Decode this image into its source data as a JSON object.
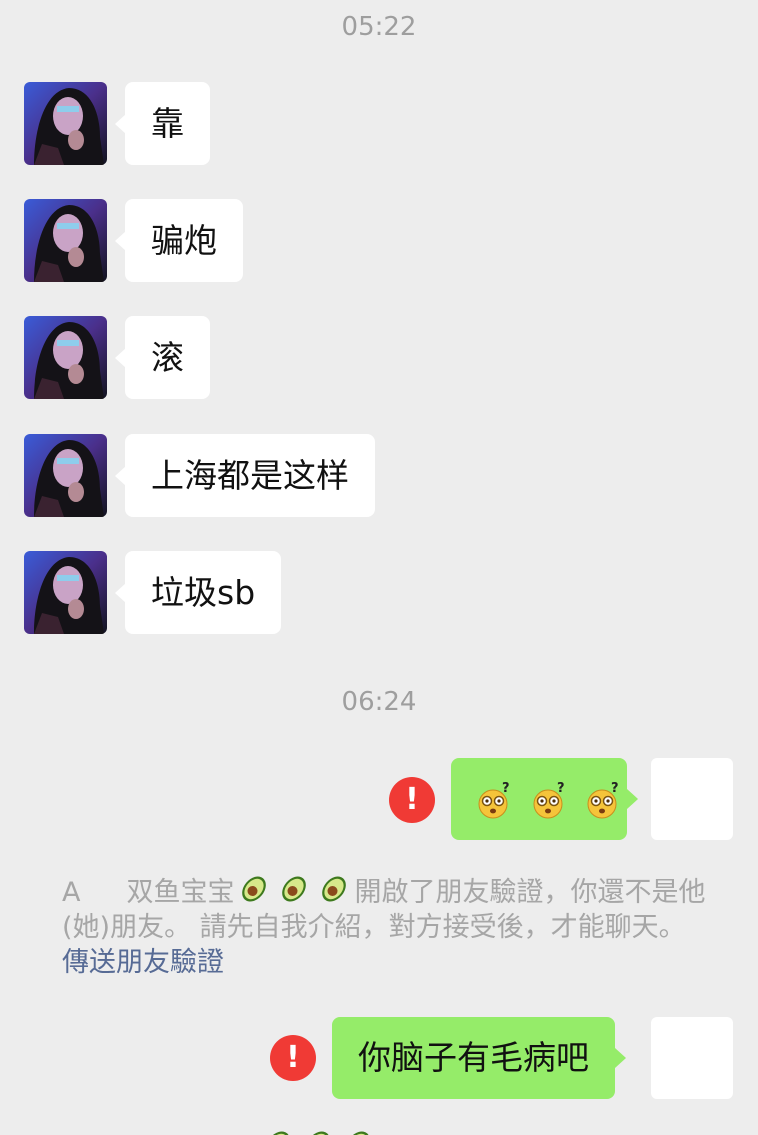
{
  "timestamps": [
    "05:22",
    "06:24"
  ],
  "incoming_messages": [
    {
      "text": "靠"
    },
    {
      "text": "骗炮"
    },
    {
      "text": "滚"
    },
    {
      "text": "上海都是这样"
    },
    {
      "text": "垃圾sb"
    }
  ],
  "outgoing_messages": [
    {
      "text": "",
      "content_icon": "dizzy-face-emoji-x3",
      "status_icon": "send-failed-icon"
    },
    {
      "text": "你脑子有毛病吧",
      "status_icon": "send-failed-icon"
    }
  ],
  "failed_mark": "!",
  "system_notice": {
    "prefix": "A",
    "name": "双鱼宝宝",
    "name_icons": [
      "avocado-emoji",
      "avocado-emoji",
      "avocado-emoji"
    ],
    "text": "開啟了朋友驗證，你還不是他(她)朋友。 請先自我介紹，對方接受後，才能聊天。",
    "link": "傳送朋友驗證"
  },
  "system_notice_partial": {
    "name_icons": [
      "avocado-emoji",
      "avocado-emoji",
      "avocado-emoji"
    ]
  },
  "colors": {
    "background": "#ededed",
    "incoming_bubble": "#ffffff",
    "outgoing_bubble": "#95ec69",
    "error": "#f03a35",
    "link": "#576b95",
    "system_text": "#a6a6a6",
    "timestamp": "#9e9e9e"
  }
}
